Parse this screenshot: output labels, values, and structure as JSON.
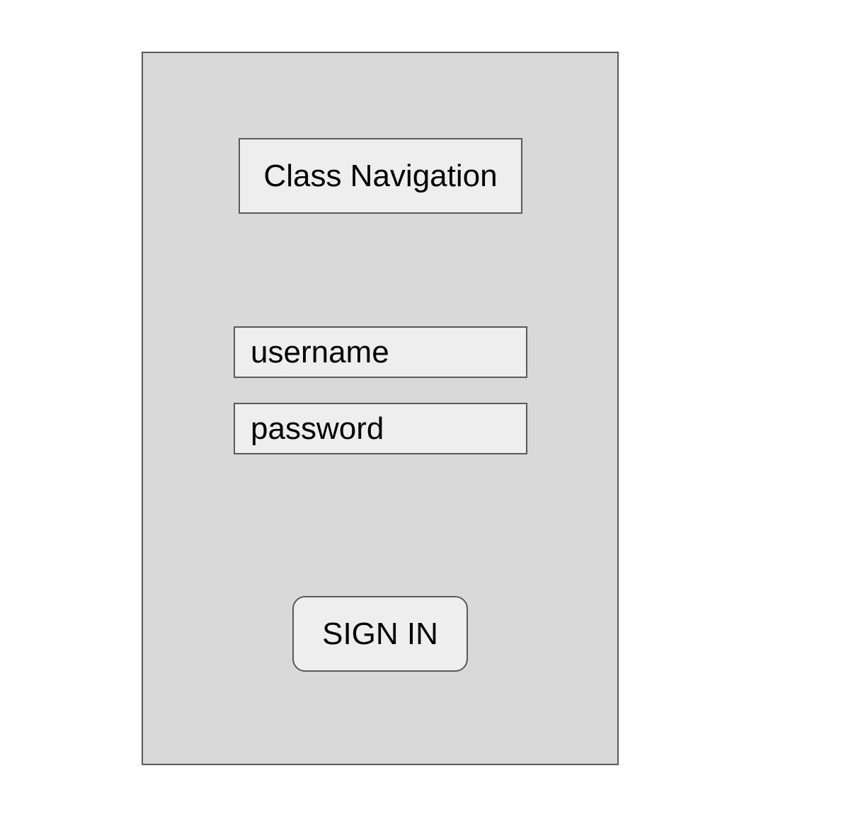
{
  "header": {
    "title": "Class Navigation"
  },
  "login": {
    "username_placeholder": "username",
    "password_placeholder": "password",
    "sign_in_label": "SIGN IN"
  },
  "colors": {
    "frame_background": "#d9d9d9",
    "box_background": "#eeeeee",
    "border": "#595959"
  }
}
